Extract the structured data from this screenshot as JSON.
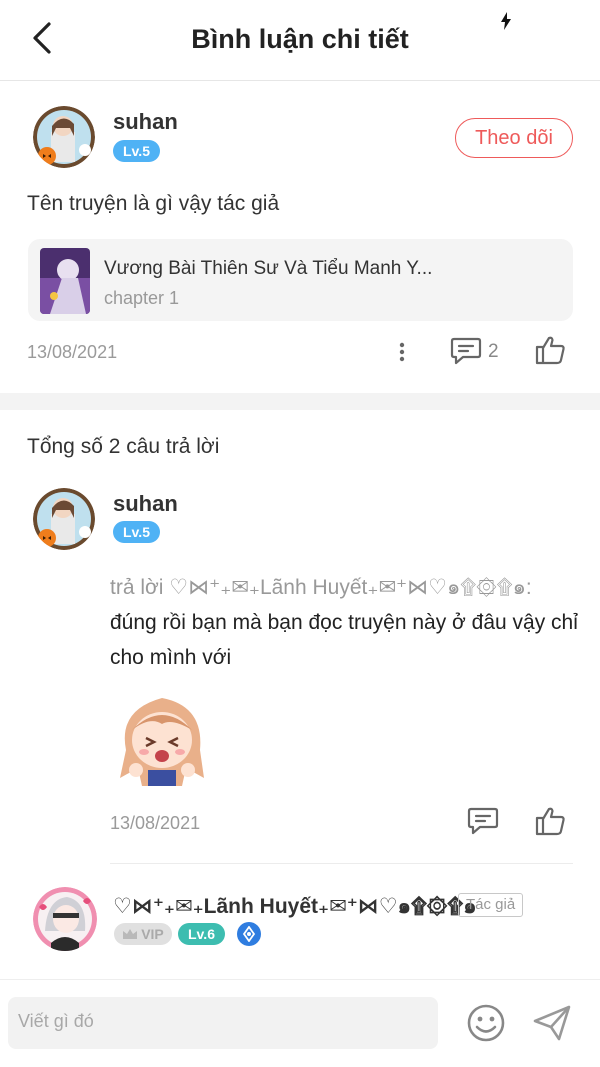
{
  "header": {
    "title": "Bình luận chi tiết"
  },
  "comment": {
    "username": "suhan",
    "level": "Lv.5",
    "follow_label": "Theo dõi",
    "text": "Tên truyện là gì vậy tác giả",
    "book": {
      "title": "Vương Bài Thiên Sư Và Tiểu Manh Y...",
      "chapter": "chapter 1"
    },
    "date": "13/08/2021",
    "reply_count": "2"
  },
  "replies_header": "Tổng số 2 câu trả lời",
  "replies": [
    {
      "username": "suhan",
      "level": "Lv.5",
      "reply_prefix": "trả lời ♡⋈⁺₊✉₊Lãnh Huyết₊✉⁺⋈♡๑۩۞۩๑:",
      "text": " đúng rồi bạn mà bạn đọc truyện này ở đâu vậy chỉ cho mình với",
      "date": "13/08/2021"
    },
    {
      "username": "♡⋈⁺₊✉₊Lãnh Huyết₊✉⁺⋈♡๑۩۞۩๑",
      "author_tag": "Tác giả",
      "vip_label": "VIP",
      "level": "Lv.6"
    }
  ],
  "input": {
    "placeholder": "Viết gì đó"
  },
  "colors": {
    "accent_red": "#ee5a5a",
    "level_blue": "#4fb2f5",
    "level_teal": "#3dbdb0"
  }
}
